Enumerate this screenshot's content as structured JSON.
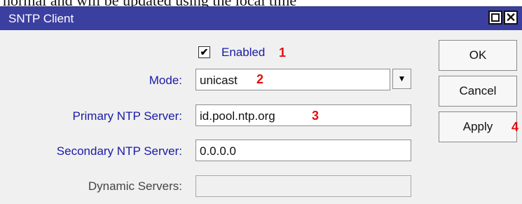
{
  "top_text": "normal and will be updated using the local time",
  "window": {
    "title": "SNTP Client",
    "maximize_glyph": "",
    "close_glyph": "✕"
  },
  "form": {
    "enabled": {
      "label": "Enabled",
      "checked_glyph": "✔",
      "annotation": "1"
    },
    "mode": {
      "label": "Mode:",
      "value": "unicast",
      "dropdown_glyph": "▼",
      "annotation": "2"
    },
    "primary": {
      "label": "Primary NTP Server:",
      "value": "id.pool.ntp.org",
      "annotation": "3"
    },
    "secondary": {
      "label": "Secondary NTP Server:",
      "value": "0.0.0.0"
    },
    "dynamic": {
      "label": "Dynamic Servers:",
      "value": ""
    }
  },
  "buttons": {
    "ok": "OK",
    "cancel": "Cancel",
    "apply": "Apply",
    "apply_annotation": "4"
  },
  "colors": {
    "titlebar": "#3b3fa0",
    "label_blue": "#1a1aa8",
    "annotation_red": "#e01010"
  }
}
